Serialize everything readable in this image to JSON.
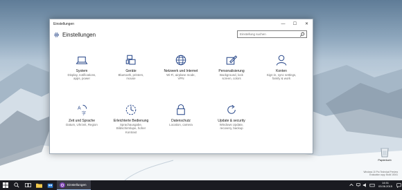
{
  "window": {
    "titlebar_title": "Einstellungen",
    "header_title": "Einstellungen",
    "search_placeholder": "Einstellung suchen",
    "controls": {
      "minimize": "—",
      "maximize": "☐",
      "close": "✕"
    }
  },
  "tiles": [
    {
      "icon": "laptop-icon",
      "name": "System",
      "desc": [
        "Display, notifications,",
        "apps, power"
      ]
    },
    {
      "icon": "devices-icon",
      "name": "Geräte",
      "desc": [
        "Bluetooth, printers,",
        "mouse"
      ]
    },
    {
      "icon": "globe-icon",
      "name": "Netzwerk und Internet",
      "desc": [
        "Wi-Fi, airplane mode,",
        "VPN"
      ]
    },
    {
      "icon": "paint-icon",
      "name": "Personalisierung",
      "desc": [
        "Background, lock",
        "screen, colors"
      ]
    },
    {
      "icon": "person-icon",
      "name": "Konten",
      "desc": [
        "Sign-in, sync settings,",
        "family & work"
      ]
    },
    {
      "icon": "time-language-icon",
      "name": "Zeit und Sprache",
      "desc": [
        "Datum, Uhrzeit, Region"
      ]
    },
    {
      "icon": "ease-of-access-icon",
      "name": "Erleichterte Bedienung",
      "desc": [
        "Sprachausgabe,",
        "Bildschirmlupe, hoher",
        "Kontrast"
      ]
    },
    {
      "icon": "lock-icon",
      "name": "Datenschutz",
      "desc": [
        "Location, camera"
      ]
    },
    {
      "icon": "update-icon",
      "name": "Update & security",
      "desc": [
        "Windows Update,",
        "recovery, backup"
      ]
    }
  ],
  "desktop": {
    "recycle_bin_label": "Papierkorb",
    "watermark": [
      "Windows 10 Pro Technical Preview",
      "Evaluation copy. Build 10041"
    ]
  },
  "taskbar": {
    "active_app_label": "Einstellungen",
    "time": "14:51",
    "date": "03.06.2015"
  },
  "colors": {
    "accent": "#2b4a8b",
    "taskbar": "#1a1b21"
  }
}
